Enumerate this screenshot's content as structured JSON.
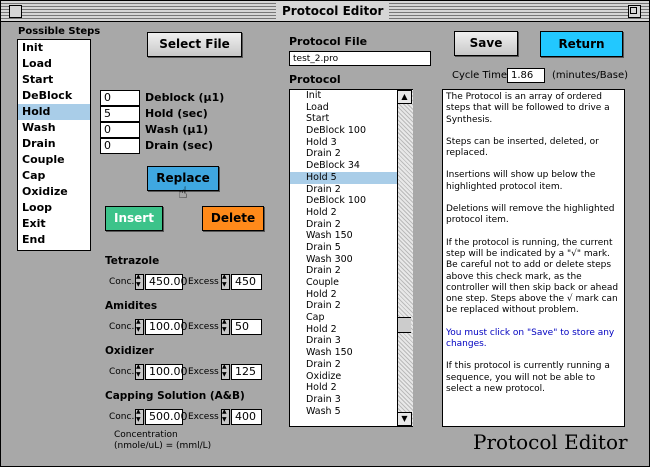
{
  "window": {
    "title": "Protocol Editor",
    "footer_title": "Protocol Editor"
  },
  "steps": {
    "heading": "Possible Steps",
    "items": [
      "Init",
      "Load",
      "Start",
      "DeBlock",
      "Hold",
      "Wash",
      "Drain",
      "Couple",
      "Cap",
      "Oxidize",
      "Loop",
      "Exit",
      "End"
    ],
    "selected_index": 4
  },
  "select_file_label": "Select File",
  "params": [
    {
      "value": "0",
      "label": "Deblock (µ1)"
    },
    {
      "value": "5",
      "label": "Hold (sec)"
    },
    {
      "value": "0",
      "label": "Wash (µ1)"
    },
    {
      "value": "0",
      "label": "Drain (sec)"
    }
  ],
  "buttons": {
    "replace": "Replace",
    "insert": "Insert",
    "delete": "Delete",
    "save": "Save",
    "return": "Return"
  },
  "colors": {
    "replace": "#3fa7e0",
    "insert": "#3cc38a",
    "delete": "#ff8a1a",
    "return": "#22c8ff",
    "selection": "#a9cde8"
  },
  "reagents": [
    {
      "name": "Tetrazole",
      "conc": "450.00",
      "excess": "450"
    },
    {
      "name": "Amidites",
      "conc": "100.00",
      "excess": "50"
    },
    {
      "name": "Oxidizer",
      "conc": "100.00",
      "excess": "125"
    },
    {
      "name": "Capping Solution (A&B)",
      "conc": "500.00",
      "excess": "400"
    }
  ],
  "conc_label": "Conc.",
  "excess_label": "Excess",
  "concentration_note": [
    "Concentration",
    "(nmole/uL) = (mml/L)"
  ],
  "protocol_file": {
    "label": "Protocol File",
    "value": "test_2.pro"
  },
  "cycle_time": {
    "label": "Cycle Time",
    "value": "1.86",
    "unit": "(minutes/Base)"
  },
  "protocol": {
    "heading": "Protocol",
    "items": [
      "Init",
      "Load",
      "Start",
      "DeBlock 100",
      "Hold 3",
      "Drain 2",
      "DeBlock 34",
      "Hold 5",
      "Drain 2",
      "DeBlock 100",
      "Hold 2",
      "Drain 2",
      "Wash 150",
      "Drain 5",
      "Wash 300",
      "Drain 2",
      "Couple",
      "Hold 2",
      "Drain 2",
      "Cap",
      "Hold 2",
      "Drain 3",
      "Wash 150",
      "Drain 2",
      "Oxidize",
      "Hold 2",
      "Drain 3",
      "Wash 5"
    ],
    "selected_index": 7
  },
  "help": [
    "The Protocol is an array of ordered steps that will be followed to drive a Synthesis.",
    "Steps can be inserted, deleted, or replaced.",
    "Insertions will show up below the highlighted protocol item.",
    "Deletions will remove the highlighted protocol item.",
    "If the protocol is running, the current step will be indicated by a \"√\" mark. Be careful not to add or delete steps above this check mark, as the controller will then skip back or ahead one step. Steps above the √ mark can be replaced without problem.",
    "You must click on \"Save\" to store any changes.",
    "If this protocol is currently running a sequence, you will not be able to select a new protocol."
  ]
}
